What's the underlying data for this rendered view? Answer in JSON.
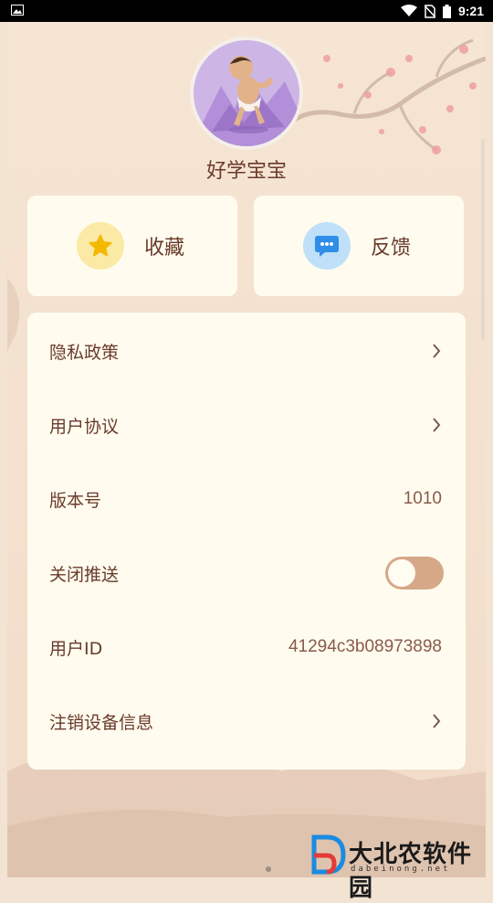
{
  "status_bar": {
    "time": "9:21"
  },
  "profile": {
    "nickname": "好学宝宝"
  },
  "actions": [
    {
      "label": "收藏",
      "icon": "star-icon",
      "color": "#f5b800"
    },
    {
      "label": "反馈",
      "icon": "chat-bubble-icon",
      "color": "#2f8fe8"
    }
  ],
  "settings": {
    "privacy": {
      "label": "隐私政策"
    },
    "agreement": {
      "label": "用户协议"
    },
    "version": {
      "label": "版本号",
      "value": "1010"
    },
    "push": {
      "label": "关闭推送",
      "enabled": false
    },
    "user_id": {
      "label": "用户ID",
      "value": "41294c3b08973898"
    },
    "deregister": {
      "label": "注销设备信息"
    }
  },
  "watermark": {
    "title": "大北农软件园",
    "subtitle": "dabeinong.net"
  },
  "colors": {
    "text": "#6a3a2a",
    "card": "#fffcef",
    "toggle_track": "#d6a888"
  }
}
